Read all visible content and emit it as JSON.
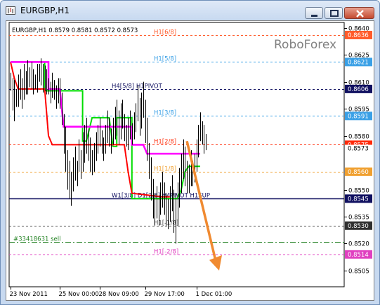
{
  "window": {
    "title": "EURGBP,H1",
    "buttons": {
      "minimize": "minimize",
      "restore": "restore",
      "close": "close"
    }
  },
  "chart_data": {
    "type": "line",
    "header": "EURGBP,H1  0.8579 0.8581 0.8572 0.8573",
    "watermark": "RoboForex",
    "ylim": [
      0.8496,
      0.8643
    ],
    "y_ticks": [
      0.8505,
      0.852,
      0.8535,
      0.855,
      0.858,
      0.8595,
      0.861,
      0.8625,
      0.864
    ],
    "x_ticks": [
      "23 Nov 2011",
      "25 Nov 00:00",
      "28 Nov 09:00",
      "29 Nov 17:00",
      "1 Dec 01:00"
    ],
    "levels": [
      {
        "label": "H1[6/8]",
        "price_tag": "0.8636",
        "value": 0.8636,
        "color": "#ff5a2a",
        "style": "dash",
        "tag_bg": "#ff5a2a",
        "tag_fg": "#ffffff"
      },
      {
        "label": "H1[5/8]",
        "price_tag": "0.8621",
        "value": 0.8621,
        "color": "#3aa0e6",
        "style": "dash",
        "tag_bg": "#3aa0e6",
        "tag_fg": "#ffffff"
      },
      {
        "label": "H4[5/8] H1PIVOT",
        "price_tag": "0.8606",
        "value": 0.8606,
        "color": "#101060",
        "style": "dash",
        "tag_bg": "#101060",
        "tag_fg": "#ffffff"
      },
      {
        "label": "H1[3/8]",
        "price_tag": "0.8591",
        "value": 0.8591,
        "color": "#3aa0e6",
        "style": "dash",
        "tag_bg": "#3aa0e6",
        "tag_fg": "#ffffff"
      },
      {
        "label": "H1[2/8]",
        "price_tag": "0.8575",
        "value": 0.8575,
        "color": "#ff3a1a",
        "style": "dash",
        "tag_bg": "#ff2a0a",
        "tag_fg": "#ffffff"
      },
      {
        "label": "H1[1/8]",
        "price_tag": "0.8560",
        "value": 0.856,
        "color": "#f0a030",
        "style": "dash",
        "tag_bg": "#f0a030",
        "tag_fg": "#ffffff"
      },
      {
        "label": "W1[3/8] D1[2/8] H4PIVOT H1SUP",
        "price_tag": "0.8545",
        "value": 0.8545,
        "color": "#101060",
        "style": "solid",
        "tag_bg": "#101060",
        "tag_fg": "#ffffff"
      },
      {
        "label": "H1[-1/8]",
        "price_tag": "0.8530",
        "value": 0.853,
        "color": "#505050",
        "style": "dash",
        "tag_bg": "#303030",
        "tag_fg": "#ffffff"
      },
      {
        "label": "#33418631 sell",
        "price_tag": "",
        "value": 0.8521,
        "color": "#208020",
        "style": "dashdot",
        "label_side": "left"
      },
      {
        "label": "H1[-2/8]",
        "price_tag": "0.8514",
        "value": 0.8514,
        "color": "#e040c0",
        "style": "dash",
        "tag_bg": "#e040c0",
        "tag_fg": "#ffffff"
      }
    ],
    "current_price_tag": "0.8573",
    "bars": [
      [
        0.8615,
        0.8605
      ],
      [
        0.8612,
        0.8594
      ],
      [
        0.8611,
        0.8588
      ],
      [
        0.8606,
        0.8596
      ],
      [
        0.8614,
        0.8596
      ],
      [
        0.8617,
        0.86
      ],
      [
        0.8612,
        0.8595
      ],
      [
        0.862,
        0.86
      ],
      [
        0.8616,
        0.8603
      ],
      [
        0.8622,
        0.8603
      ],
      [
        0.8618,
        0.8607
      ],
      [
        0.8621,
        0.8606
      ],
      [
        0.8617,
        0.8603
      ],
      [
        0.8614,
        0.8606
      ],
      [
        0.862,
        0.8604
      ],
      [
        0.862,
        0.861
      ],
      [
        0.8623,
        0.8608
      ],
      [
        0.862,
        0.8604
      ],
      [
        0.8619,
        0.8605
      ],
      [
        0.8617,
        0.8603
      ],
      [
        0.8612,
        0.8603
      ],
      [
        0.861,
        0.8598
      ],
      [
        0.8615,
        0.8601
      ],
      [
        0.8611,
        0.86
      ],
      [
        0.8608,
        0.8595
      ],
      [
        0.8612,
        0.8598
      ],
      [
        0.8612,
        0.8595
      ],
      [
        0.8604,
        0.8586
      ],
      [
        0.8592,
        0.857
      ],
      [
        0.8585,
        0.856
      ],
      [
        0.8572,
        0.855
      ],
      [
        0.8566,
        0.8545
      ],
      [
        0.856,
        0.8541
      ],
      [
        0.8568,
        0.8549
      ],
      [
        0.8574,
        0.8555
      ],
      [
        0.8566,
        0.8552
      ],
      [
        0.8578,
        0.856
      ],
      [
        0.8572,
        0.8556
      ],
      [
        0.8582,
        0.856
      ],
      [
        0.8586,
        0.8565
      ],
      [
        0.859,
        0.857
      ],
      [
        0.8584,
        0.8566
      ],
      [
        0.8579,
        0.856
      ],
      [
        0.8572,
        0.8558
      ],
      [
        0.8576,
        0.856
      ],
      [
        0.8582,
        0.8566
      ],
      [
        0.8586,
        0.857
      ],
      [
        0.859,
        0.8574
      ],
      [
        0.8583,
        0.857
      ],
      [
        0.8579,
        0.8566
      ],
      [
        0.8586,
        0.857
      ],
      [
        0.8594,
        0.8576
      ],
      [
        0.859,
        0.8574
      ],
      [
        0.8584,
        0.857
      ],
      [
        0.859,
        0.8575
      ],
      [
        0.8596,
        0.8578
      ],
      [
        0.86,
        0.858
      ],
      [
        0.8594,
        0.8575
      ],
      [
        0.8598,
        0.8578
      ],
      [
        0.86,
        0.8584
      ],
      [
        0.8592,
        0.8577
      ],
      [
        0.8586,
        0.8574
      ],
      [
        0.859,
        0.8572
      ],
      [
        0.8594,
        0.8578
      ],
      [
        0.8587,
        0.8575
      ],
      [
        0.8593,
        0.8578
      ],
      [
        0.8598,
        0.8582
      ],
      [
        0.8608,
        0.8588
      ],
      [
        0.8601,
        0.858
      ],
      [
        0.8604,
        0.8584
      ],
      [
        0.861,
        0.859
      ],
      [
        0.86,
        0.8576
      ],
      [
        0.859,
        0.8566
      ],
      [
        0.8576,
        0.8556
      ],
      [
        0.8568,
        0.8544
      ],
      [
        0.8556,
        0.8534
      ],
      [
        0.8548,
        0.853
      ],
      [
        0.8552,
        0.8534
      ],
      [
        0.8547,
        0.853
      ],
      [
        0.8554,
        0.8536
      ],
      [
        0.856,
        0.854
      ],
      [
        0.8554,
        0.8536
      ],
      [
        0.8548,
        0.853
      ],
      [
        0.8545,
        0.8528
      ],
      [
        0.8552,
        0.8532
      ],
      [
        0.8558,
        0.8538
      ],
      [
        0.855,
        0.8526
      ],
      [
        0.8548,
        0.852
      ],
      [
        0.8554,
        0.853
      ],
      [
        0.8562,
        0.854
      ],
      [
        0.857,
        0.8548
      ],
      [
        0.8578,
        0.8556
      ],
      [
        0.8574,
        0.8552
      ],
      [
        0.8566,
        0.8548
      ],
      [
        0.8564,
        0.8548
      ],
      [
        0.8572,
        0.8552
      ],
      [
        0.8566,
        0.8552
      ],
      [
        0.857,
        0.8554
      ],
      [
        0.8578,
        0.856
      ],
      [
        0.8586,
        0.8568
      ],
      [
        0.8593,
        0.8577
      ],
      [
        0.8588,
        0.8575
      ],
      [
        0.8586,
        0.857
      ],
      [
        0.8581,
        0.8572
      ]
    ],
    "series": [
      {
        "name": "",
        "color": "#00dd00",
        "points": [
          [
            0,
            0.8621
          ],
          [
            18,
            0.8621
          ],
          [
            18,
            0.8605
          ],
          [
            38,
            0.8605
          ],
          [
            38,
            0.8577
          ],
          [
            40,
            0.8577
          ],
          [
            43,
            0.859
          ],
          [
            47,
            0.859
          ],
          [
            52,
            0.859
          ],
          [
            54,
            0.8574
          ],
          [
            56,
            0.8574
          ],
          [
            56,
            0.859
          ],
          [
            64,
            0.859
          ],
          [
            64,
            0.8545
          ],
          [
            88,
            0.8545
          ],
          [
            90,
            0.855
          ],
          [
            92,
            0.856
          ],
          [
            94,
            0.8563
          ],
          [
            100,
            0.8563
          ]
        ]
      },
      {
        "name": "",
        "color": "#ff0000",
        "points": [
          [
            0,
            0.8621
          ],
          [
            2,
            0.8612
          ],
          [
            4,
            0.8606
          ],
          [
            12,
            0.8606
          ],
          [
            18,
            0.8606
          ],
          [
            20,
            0.858
          ],
          [
            22,
            0.8575
          ],
          [
            36,
            0.8575
          ],
          [
            38,
            0.8575
          ],
          [
            42,
            0.8575
          ],
          [
            44,
            0.8575
          ],
          [
            50,
            0.8575
          ],
          [
            60,
            0.8575
          ],
          [
            62,
            0.856
          ],
          [
            64,
            0.8548
          ],
          [
            80,
            0.8546
          ],
          [
            84,
            0.8546
          ]
        ]
      },
      {
        "name": "",
        "color": "#ff00ff",
        "points": [
          [
            0,
            0.8621
          ],
          [
            20,
            0.8621
          ],
          [
            20,
            0.8606
          ],
          [
            26,
            0.8606
          ],
          [
            28,
            0.8585
          ],
          [
            36,
            0.8585
          ],
          [
            56,
            0.8585
          ],
          [
            64,
            0.8585
          ],
          [
            64,
            0.8575
          ],
          [
            70,
            0.8575
          ],
          [
            72,
            0.857
          ],
          [
            100,
            0.857
          ]
        ]
      }
    ],
    "arrow": {
      "from": [
        93,
        0.8577
      ],
      "to": [
        110,
        0.8505
      ],
      "color": "#f08a30"
    }
  }
}
